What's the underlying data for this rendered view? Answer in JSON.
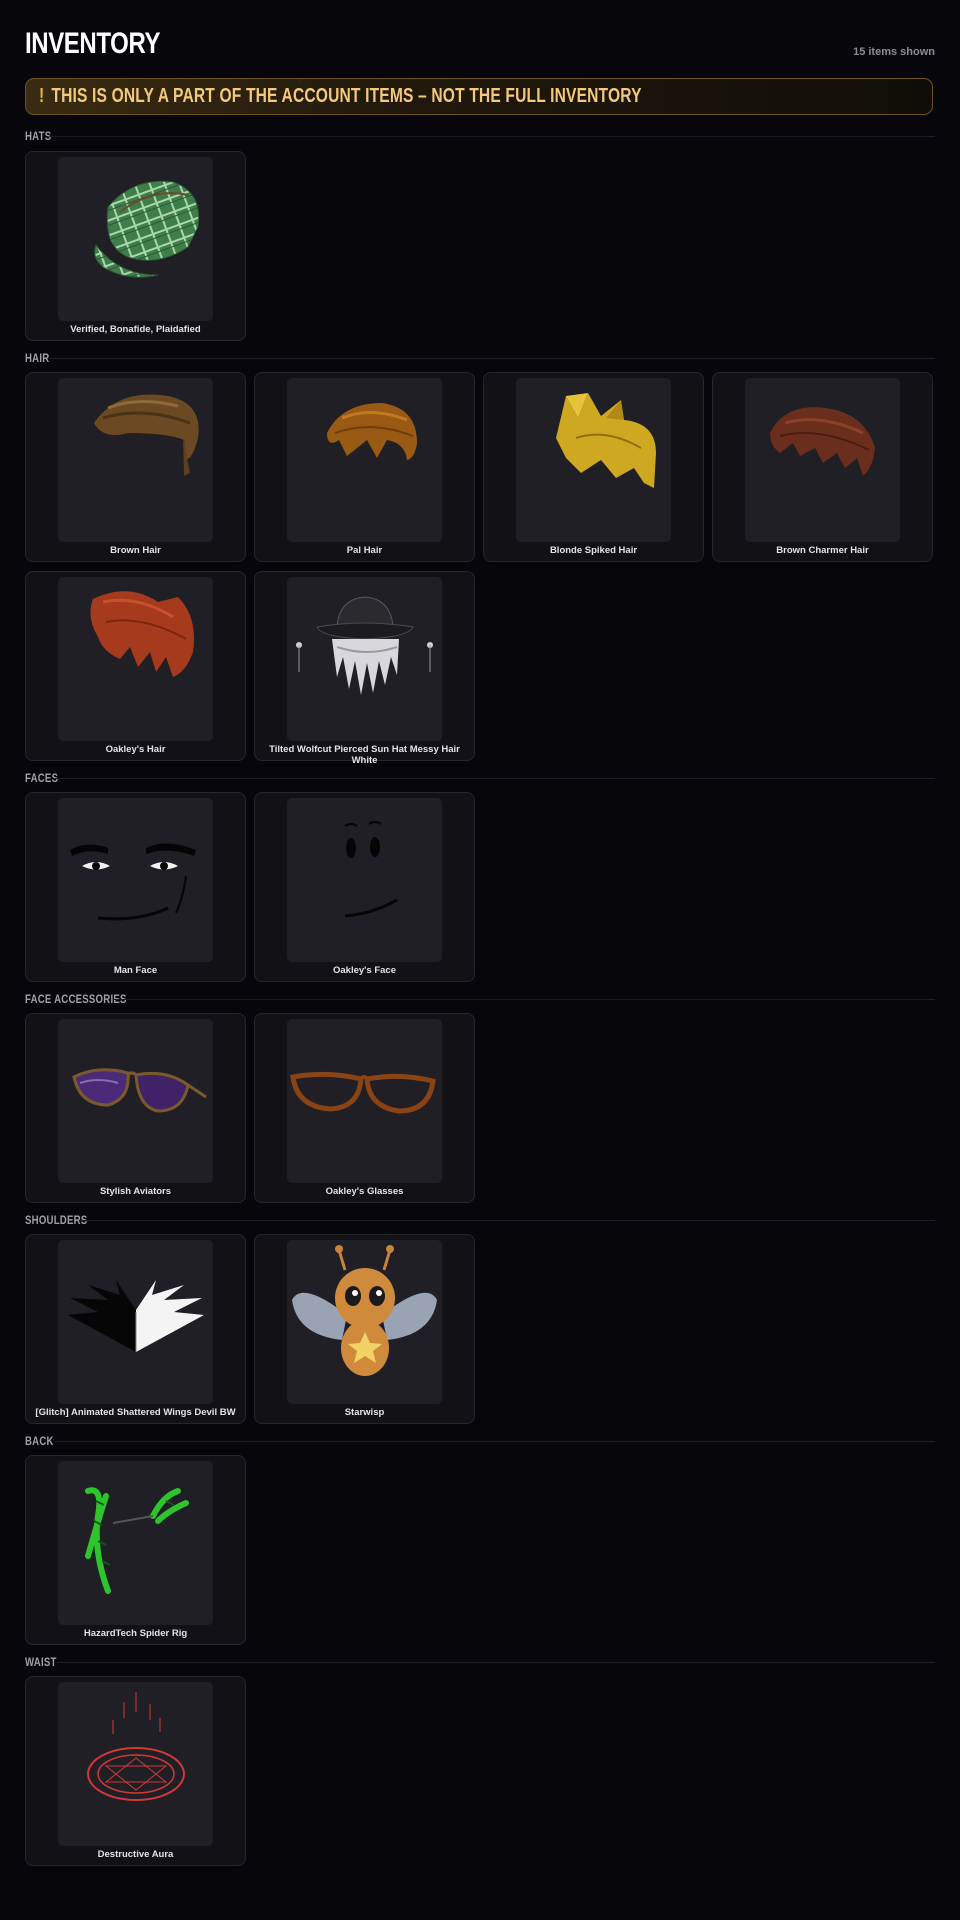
{
  "header": {
    "title": "INVENTORY",
    "count": "15 items shown"
  },
  "banner": {
    "icon": "!",
    "text": "THIS IS ONLY A PART OF THE ACCOUNT ITEMS – NOT THE FULL INVENTORY"
  },
  "colors": {
    "background": "#07070b",
    "card": "#111116",
    "accent": "#f4c97a"
  },
  "sections": [
    {
      "title": "HATS",
      "items": [
        {
          "name": "Verified, Bonafide, Plaidafied",
          "icon": "plaid-cap-icon"
        }
      ]
    },
    {
      "title": "HAIR",
      "items": [
        {
          "name": "Brown Hair",
          "icon": "brown-hair-icon"
        },
        {
          "name": "Pal Hair",
          "icon": "pal-hair-icon"
        },
        {
          "name": "Blonde Spiked Hair",
          "icon": "blonde-spiked-hair-icon"
        },
        {
          "name": "Brown Charmer Hair",
          "icon": "brown-charmer-hair-icon"
        },
        {
          "name": "Oakley's Hair",
          "icon": "red-hair-icon"
        },
        {
          "name": "Tilted Wolfcut Pierced Sun Hat Messy Hair White",
          "icon": "sun-hat-white-hair-icon"
        }
      ]
    },
    {
      "title": "FACES",
      "items": [
        {
          "name": "Man Face",
          "icon": "man-face-icon"
        },
        {
          "name": "Oakley's Face",
          "icon": "smile-face-icon"
        }
      ]
    },
    {
      "title": "FACE ACCESSORIES",
      "items": [
        {
          "name": "Stylish Aviators",
          "icon": "aviators-icon"
        },
        {
          "name": "Oakley's Glasses",
          "icon": "glasses-icon"
        }
      ]
    },
    {
      "title": "SHOULDERS",
      "items": [
        {
          "name": "[Glitch] Animated Shattered Wings Devil BW",
          "icon": "wings-icon"
        },
        {
          "name": "Starwisp",
          "icon": "starwisp-icon"
        }
      ]
    },
    {
      "title": "BACK",
      "items": [
        {
          "name": "HazardTech Spider Rig",
          "icon": "spider-rig-icon"
        }
      ]
    },
    {
      "title": "WAIST",
      "items": [
        {
          "name": "Destructive Aura",
          "icon": "aura-icon"
        }
      ]
    }
  ]
}
